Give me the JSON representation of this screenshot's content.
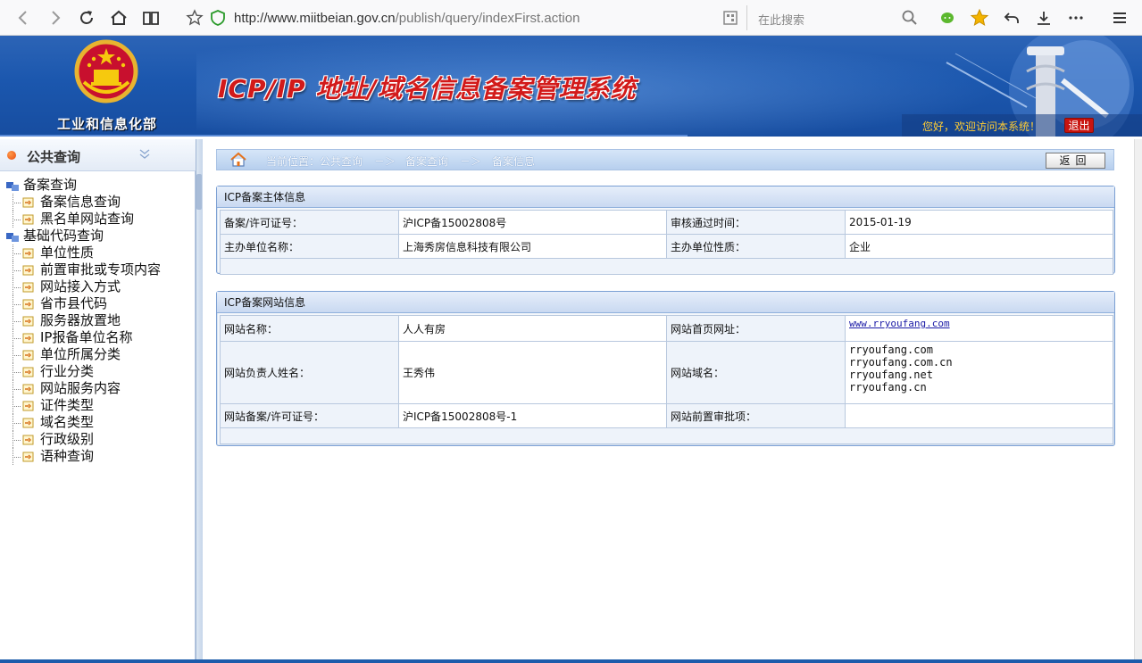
{
  "browser": {
    "url_host": "http://www.miitbeian.gov.cn",
    "url_path": "/publish/query/indexFirst.action",
    "search_placeholder": "在此搜索"
  },
  "header": {
    "ministry": "工业和信息化部",
    "title": "ICP/IP 地址/域名信息备案管理系统",
    "welcome": "您好，欢迎访问本系统！",
    "logout": "退出"
  },
  "sidebar": {
    "title": "公共查询",
    "groups": [
      {
        "label": "备案查询",
        "items": [
          "备案信息查询",
          "黑名单网站查询"
        ]
      },
      {
        "label": "基础代码查询",
        "items": [
          "单位性质",
          "前置审批或专项内容",
          "网站接入方式",
          "省市县代码",
          "服务器放置地",
          "IP报备单位名称",
          "单位所属分类",
          "行业分类",
          "网站服务内容",
          "证件类型",
          "域名类型",
          "行政级别",
          "语种查询"
        ]
      }
    ]
  },
  "breadcrumb": {
    "prefix": "当前位置：公共查询",
    "sep1": "－＞",
    "level2": "备案查询",
    "sep2": "－＞",
    "level3": "备案信息",
    "back": "返回"
  },
  "entity_panel": {
    "title": "ICP备案主体信息",
    "license_label": "备案/许可证号：",
    "license_value": "沪ICP备15002808号",
    "approve_label": "审核通过时间：",
    "approve_value": "2015-01-19",
    "org_label": "主办单位名称：",
    "org_value": "上海秀房信息科技有限公司",
    "org_type_label": "主办单位性质：",
    "org_type_value": "企业"
  },
  "site_panel": {
    "title": "ICP备案网站信息",
    "site_name_label": "网站名称：",
    "site_name_value": "人人有房",
    "home_url_label": "网站首页网址：",
    "home_url_value": "www.rryoufang.com",
    "owner_label": "网站负责人姓名：",
    "owner_value": "王秀伟",
    "domain_label": "网站域名：",
    "domains": [
      "rryoufang.com",
      "rryoufang.com.cn",
      "rryoufang.net",
      "rryoufang.cn"
    ],
    "site_license_label": "网站备案/许可证号：",
    "site_license_value": "沪ICP备15002808号-1",
    "preapproval_label": "网站前置审批项：",
    "preapproval_value": ""
  },
  "colors": {
    "header_blue": "#1b57ae",
    "title_red": "#d21a1a",
    "panel_border": "#7b9fd3"
  }
}
